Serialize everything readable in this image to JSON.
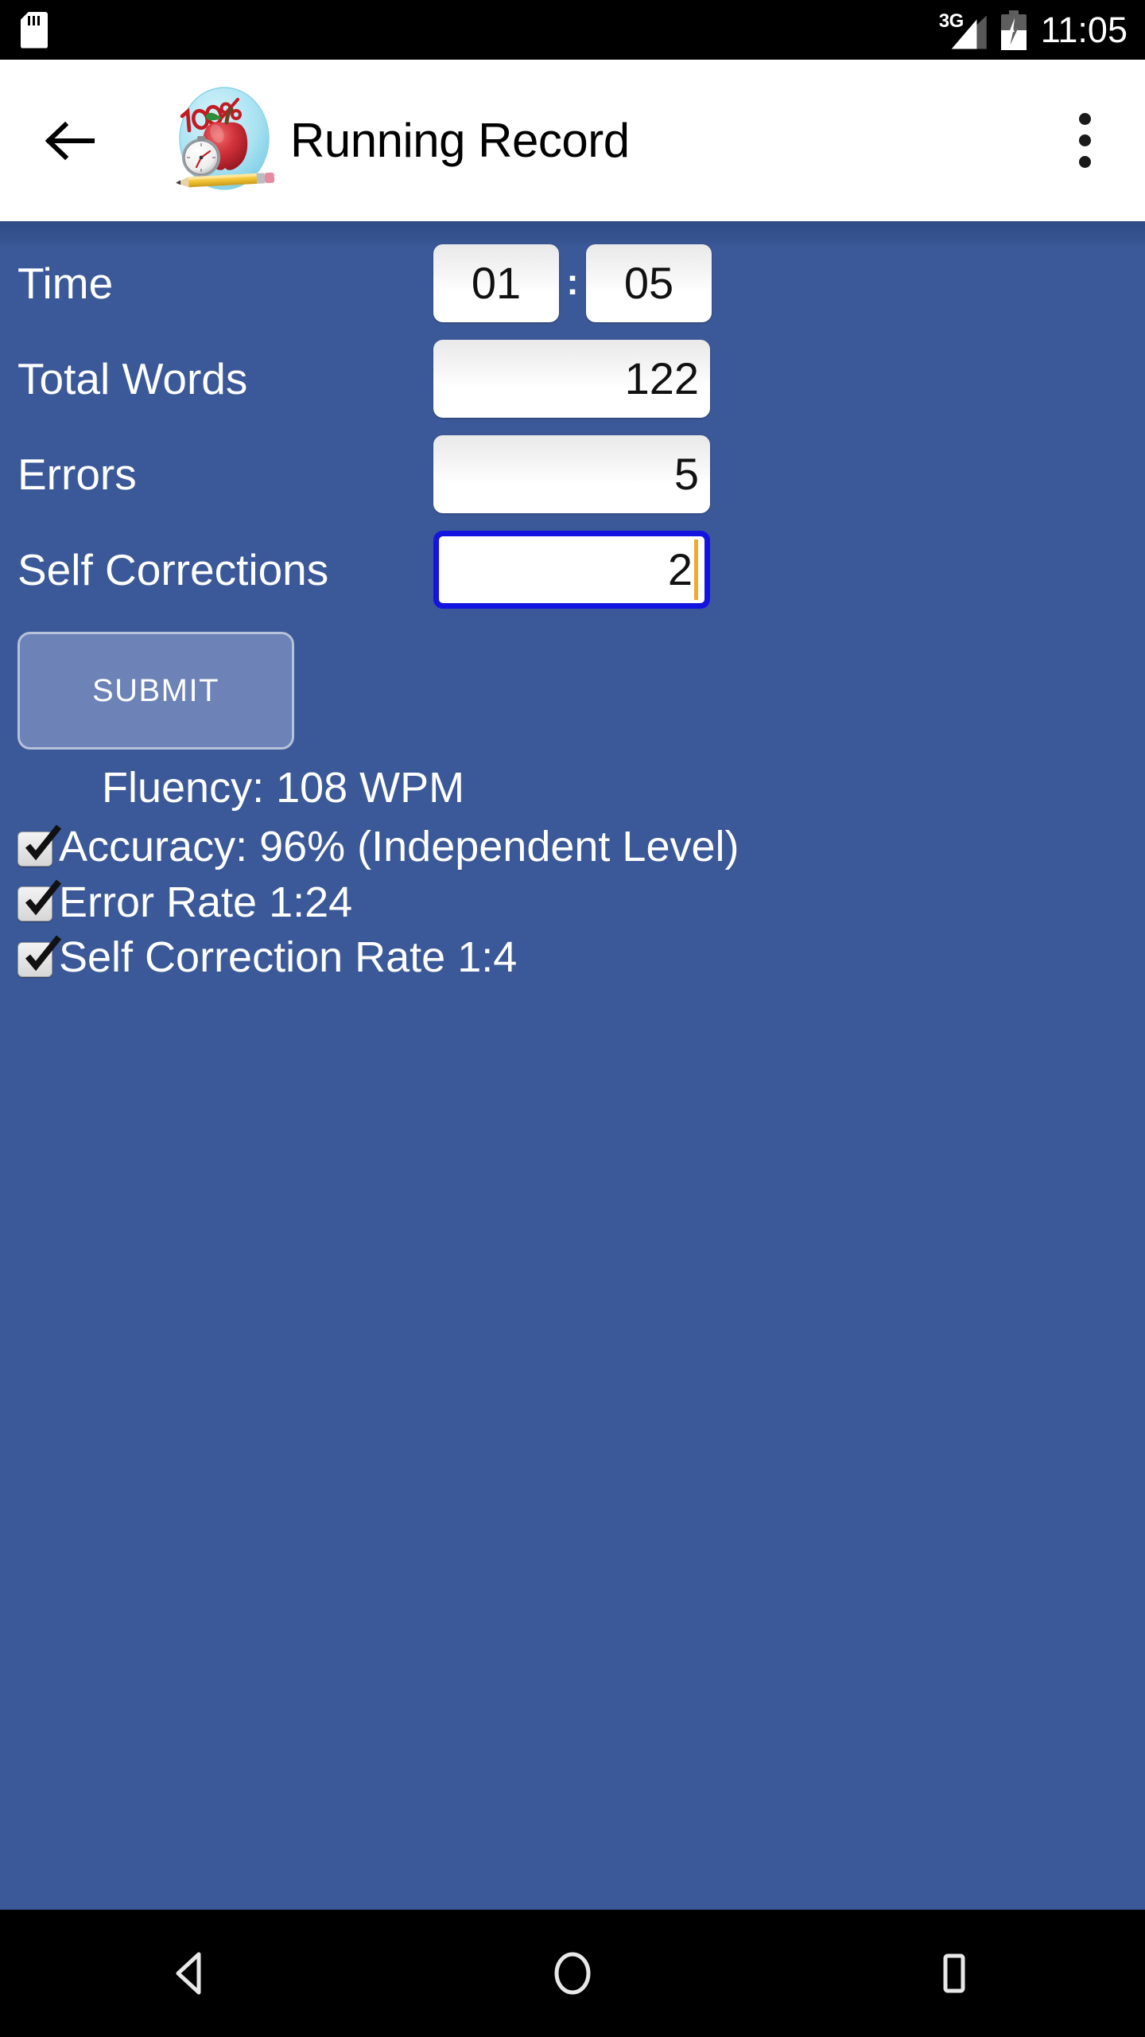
{
  "status_bar": {
    "sd_card_icon": "sd-card-icon",
    "network_label": "3G",
    "signal_icon": "signal-bars-icon",
    "battery_icon": "battery-charging-icon",
    "time": "11:05"
  },
  "app_bar": {
    "back_icon": "back-arrow-icon",
    "app_icon": "apple-stopwatch-pencil-100-percent-icon",
    "title": "Running Record",
    "overflow_icon": "overflow-menu-icon"
  },
  "form": {
    "time": {
      "label": "Time",
      "minutes": "01",
      "separator": ":",
      "seconds": "05"
    },
    "total_words": {
      "label": "Total Words",
      "value": "122"
    },
    "errors": {
      "label": "Errors",
      "value": "5"
    },
    "self_corrections": {
      "label": "Self Corrections",
      "value": "2",
      "focused": true
    },
    "submit_label": "SUBMIT"
  },
  "results": {
    "fluency": "Fluency: 108 WPM",
    "items": [
      {
        "label": "Accuracy: 96% (Independent Level)",
        "checked": true
      },
      {
        "label": "Error Rate 1:24",
        "checked": true
      },
      {
        "label": "Self Correction Rate 1:4",
        "checked": true
      }
    ]
  },
  "nav_bar": {
    "back_icon": "nav-back-triangle-icon",
    "home_icon": "nav-home-circle-icon",
    "recents_icon": "nav-recents-square-icon"
  },
  "colors": {
    "background": "#3b5998",
    "app_bar": "#ffffff",
    "system_bar": "#000000",
    "submit_button": "#6d83b8",
    "focus_border": "#1414e0",
    "caret": "#f0a830",
    "text_on_blue": "#ffffff"
  }
}
